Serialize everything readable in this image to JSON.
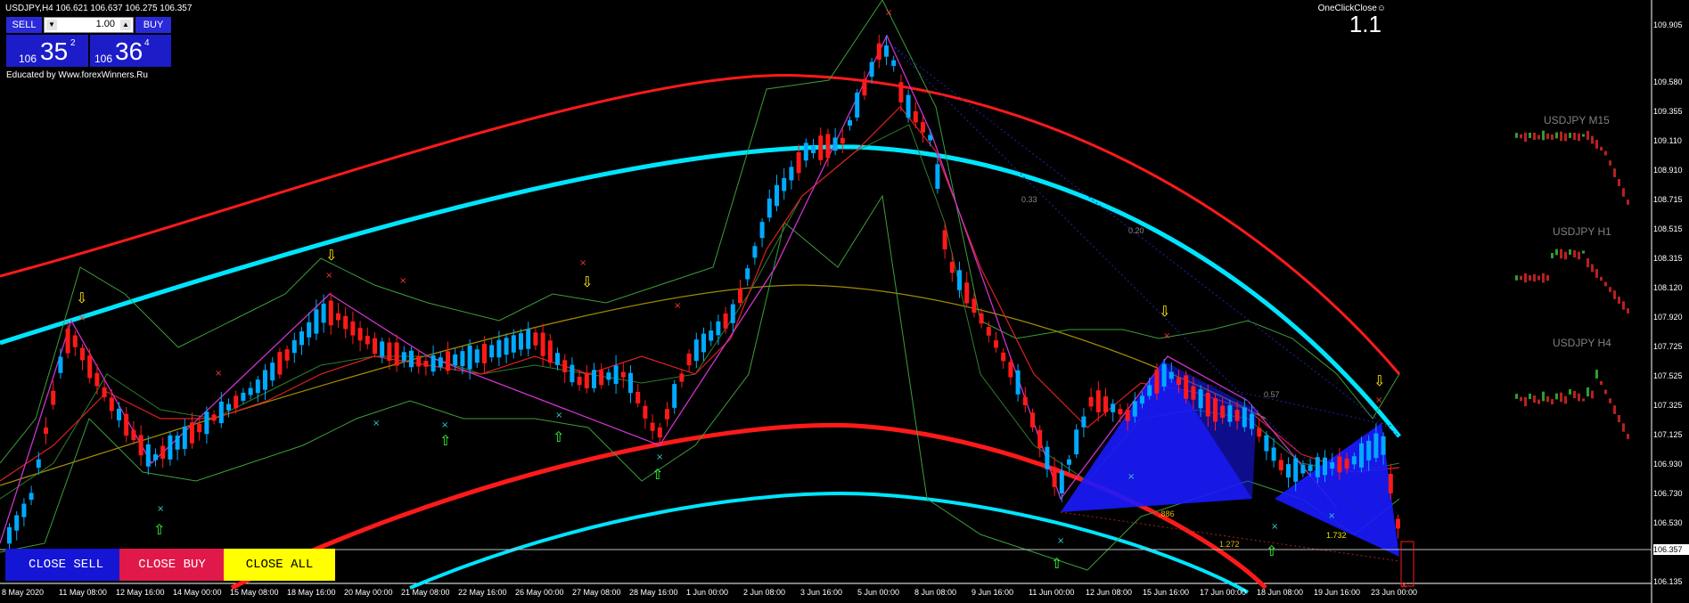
{
  "header": {
    "symbol_line": "USDJPY,H4  106.621 106.637 106.275 106.357"
  },
  "trade_panel": {
    "sell_label": "SELL",
    "buy_label": "BUY",
    "lot": "1.00",
    "lot_down_icon": "triangle-down",
    "lot_up_icon": "triangle-up",
    "sell_price": {
      "prefix": "106",
      "big": "35",
      "sup": "2"
    },
    "buy_price": {
      "prefix": "106",
      "big": "36",
      "sup": "4"
    }
  },
  "educated_by": "Educated by Www.forexWinners.Ru",
  "oneclick": {
    "label": "OneClickClose☺",
    "spread": "1.1"
  },
  "price_axis": [
    "109.905",
    "109.580",
    "109.355",
    "109.110",
    "108.910",
    "108.715",
    "108.515",
    "108.315",
    "108.120",
    "107.920",
    "107.725",
    "107.525",
    "107.325",
    "107.125",
    "106.930",
    "106.730",
    "106.530",
    "106.135"
  ],
  "current_price": "106.357",
  "time_axis": [
    "8 May 2020",
    "11 May 08:00",
    "12 May 16:00",
    "14 May 00:00",
    "15 May 08:00",
    "18 May 16:00",
    "20 May 00:00",
    "21 May 08:00",
    "22 May 16:00",
    "26 May 00:00",
    "27 May 08:00",
    "28 May 16:00",
    "1 Jun 00:00",
    "2 Jun 08:00",
    "3 Jun 16:00",
    "5 Jun 00:00",
    "8 Jun 08:00",
    "9 Jun 16:00",
    "11 Jun 00:00",
    "12 Jun 08:00",
    "15 Jun 16:00",
    "17 Jun 00:00",
    "18 Jun 08:00",
    "19 Jun 16:00",
    "23 Jun 00:00"
  ],
  "mini_charts": [
    {
      "title": "USDJPY M15"
    },
    {
      "title": "USDJPY H1"
    },
    {
      "title": "USDJPY H4"
    }
  ],
  "fib_labels": [
    "0.33",
    "0.20",
    "0.57",
    ".886",
    "1.272",
    "1.732"
  ],
  "bottom_buttons": {
    "close_sell": "CLOSE SELL",
    "close_buy": "CLOSE BUY",
    "close_all": "CLOSE ALL"
  },
  "colors": {
    "background": "#000000",
    "bull_candle": "#00aaff",
    "bear_candle": "#ff1a1a",
    "cyan_band": "#00e5ff",
    "red_band": "#ff1a1a",
    "pattern_fill": "#1a1aff",
    "zigzag": "#cc33cc",
    "bollinger": "#3c9e3c"
  }
}
